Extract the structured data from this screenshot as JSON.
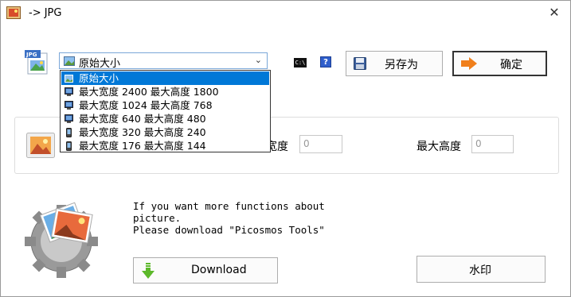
{
  "window": {
    "title": "-> JPG",
    "close_symbol": "✕"
  },
  "size_select": {
    "value": "原始大小",
    "options": [
      {
        "label": "原始大小",
        "icon": "landscape-icon",
        "selected": true
      },
      {
        "label": "最大宽度 2400 最大高度 1800",
        "icon": "monitor-icon"
      },
      {
        "label": "最大宽度 1024 最大高度 768",
        "icon": "monitor-icon"
      },
      {
        "label": "最大宽度 640 最大高度 480",
        "icon": "monitor-icon"
      },
      {
        "label": "最大宽度 320 最大高度 240",
        "icon": "phone-icon"
      },
      {
        "label": "最大宽度 176 最大高度 144",
        "icon": "phone-icon"
      }
    ]
  },
  "toolbar": {
    "cmd_label": "C:\\",
    "help_label": "?",
    "save_as_label": "另存为",
    "ok_label": "确定"
  },
  "resize": {
    "width_label": "宽度",
    "width_value": "0",
    "height_label": "最大高度",
    "height_value": "0"
  },
  "promo": {
    "text": "If you want more functions about\npicture.\nPlease download \"Picosmos Tools\""
  },
  "buttons": {
    "download_label": "Download",
    "watermark_label": "水印"
  },
  "colors": {
    "selection": "#0078d7",
    "select_border": "#7aa7d8",
    "ok_arrow": "#f07f1b",
    "download_arrow": "#5cb82a"
  }
}
